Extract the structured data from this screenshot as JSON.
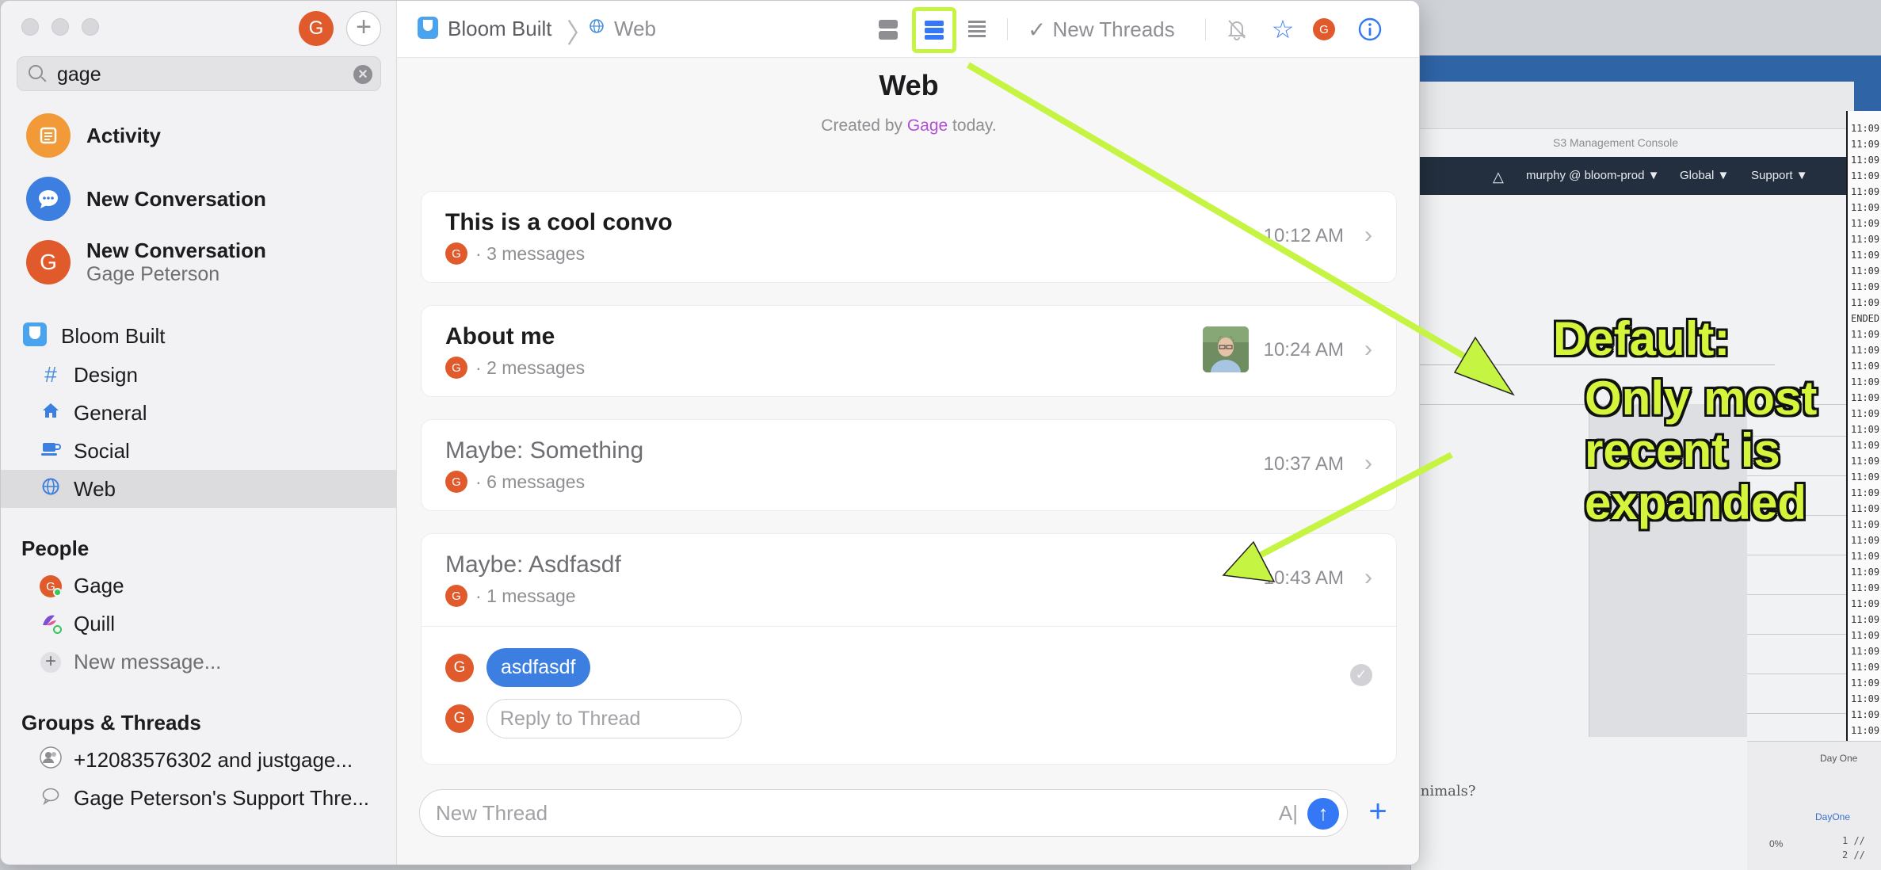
{
  "colors": {
    "accent": "#3478f6",
    "avatar_orange": "#e05a2b",
    "annotation_green": "#c5f542",
    "link_purple": "#b34fd6"
  },
  "sidebar": {
    "avatar_initial": "G",
    "compose_icon": "plus-icon",
    "search": {
      "value": "gage",
      "icon": "search-icon"
    },
    "top_items": [
      {
        "title": "Activity",
        "icon": "activity-icon"
      },
      {
        "title": "New Conversation",
        "icon": "chat-bubble-icon"
      },
      {
        "title": "New Conversation",
        "subtitle": "Gage Peterson",
        "avatar": "G"
      }
    ],
    "space": {
      "name": "Bloom Built",
      "channels": [
        {
          "label": "Design",
          "icon": "hash-icon"
        },
        {
          "label": "General",
          "icon": "house-icon"
        },
        {
          "label": "Social",
          "icon": "coffee-cup-icon"
        },
        {
          "label": "Web",
          "icon": "globe-icon",
          "active": true
        }
      ]
    },
    "people": {
      "heading": "People",
      "items": [
        {
          "label": "Gage",
          "avatar": "G"
        },
        {
          "label": "Quill",
          "icon": "quill-icon"
        },
        {
          "label": "New message...",
          "icon": "plus-icon"
        }
      ]
    },
    "groups": {
      "heading": "Groups & Threads",
      "items": [
        {
          "label": "+12083576302 and justgage...",
          "icon": "group-icon"
        },
        {
          "label": "Gage Peterson's Support Thre...",
          "icon": "speech-bubble-icon"
        }
      ]
    }
  },
  "header": {
    "breadcrumb_space": "Bloom Built",
    "breadcrumb_channel": "Web",
    "new_threads_label": "New Threads",
    "avatar_initial": "G"
  },
  "channel": {
    "title": "Web",
    "created_prefix": "Created by ",
    "created_by": "Gage",
    "created_suffix": " today."
  },
  "threads": [
    {
      "title": "This is a cool convo",
      "avatar": "G",
      "count": "3 messages",
      "time": "10:12 AM"
    },
    {
      "title": "About me",
      "avatar": "G",
      "count": "2 messages",
      "time": "10:24 AM"
    },
    {
      "title": "Maybe: Something",
      "avatar": "G",
      "count": "6 messages",
      "time": "10:37 AM"
    },
    {
      "title": "Maybe: Asdfasdf",
      "avatar": "G",
      "count": "1 message",
      "time": "10:43 AM",
      "message": "asdfasdf",
      "reply_placeholder": "Reply to Thread"
    }
  ],
  "composer": {
    "placeholder": "New Thread",
    "format_label": "A|"
  },
  "background": {
    "aws_title": "S3 Management Console",
    "aws_user": "murphy @ bloom-prod ▼",
    "aws_region": "Global ▼",
    "aws_support": "Support ▼",
    "page_text": "animals?",
    "term_lines": [
      "11:09",
      "11:09",
      "11:09",
      "11:09",
      "11:09",
      "11:09",
      "11:09",
      "11:09",
      "11:09",
      "11:09",
      "11:09",
      "11:09",
      "ENDED",
      "11:09",
      "11:09",
      "11:09",
      "11:09",
      "11:09",
      "11:09",
      "11:09",
      "11:09",
      "11:09",
      "11:09",
      "11:09",
      "11:09",
      "11:09",
      "11:09",
      "11:09",
      "11:09",
      "11:09",
      "11:09",
      "11:09",
      "11:09",
      "11:09",
      "11:09",
      "11:09",
      "11:09",
      "11:09",
      "11:09",
      "11:09",
      "11:09",
      "11:09",
      "11:09"
    ],
    "xcode_tab": "Day One",
    "xcode_folder": "DayOne",
    "xcode_percent": "0%",
    "xcode_line1": "1  //",
    "xcode_line2": "2  //"
  },
  "annotations": {
    "line1": "Default:",
    "line2": "Only most",
    "line3": "recent is",
    "line4": "expanded"
  }
}
